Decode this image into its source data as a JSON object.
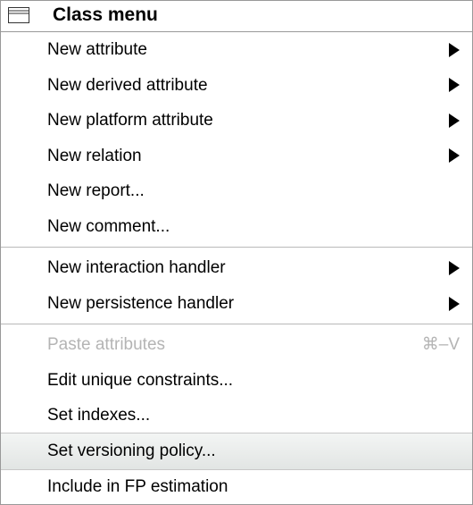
{
  "header": {
    "title": "Class menu"
  },
  "items": [
    {
      "label": "New attribute",
      "submenu": true
    },
    {
      "label": "New derived attribute",
      "submenu": true
    },
    {
      "label": "New platform attribute",
      "submenu": true
    },
    {
      "label": "New relation",
      "submenu": true
    },
    {
      "label": "New report..."
    },
    {
      "label": "New comment..."
    },
    {
      "label": "New interaction handler",
      "submenu": true
    },
    {
      "label": "New persistence handler",
      "submenu": true
    },
    {
      "label": "Paste attributes",
      "shortcut": "⌘–V",
      "disabled": true
    },
    {
      "label": "Edit unique constraints..."
    },
    {
      "label": "Set indexes..."
    },
    {
      "label": "Set versioning policy...",
      "highlight": true
    },
    {
      "label": "Include in FP estimation"
    }
  ]
}
